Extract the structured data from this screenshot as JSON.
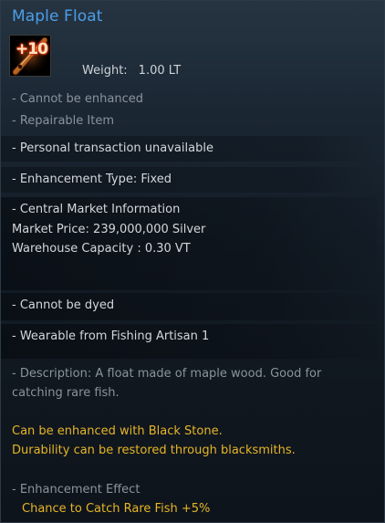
{
  "item": {
    "name": "Maple Float",
    "enhancement_badge": "+10",
    "icon": "maple-float-item-icon",
    "weight_label": "Weight:",
    "weight_value": "1.00 LT"
  },
  "properties": {
    "cannot_be_enhanced": "- Cannot be enhanced",
    "repairable": "- Repairable Item",
    "personal_transaction": "- Personal transaction unavailable",
    "enhancement_type": "- Enhancement Type: Fixed"
  },
  "market": {
    "heading": "- Central Market Information",
    "price": "Market Price: 239,000,000 Silver",
    "warehouse_capacity": "Warehouse Capacity : 0.30 VT"
  },
  "dye": "- Cannot be dyed",
  "wearable": "- Wearable from Fishing Artisan 1",
  "description": {
    "line1": "- Description: A float made of maple wood. Good for",
    "line2": "catching rare fish."
  },
  "notes": {
    "black_stone": "Can be enhanced with Black Stone.",
    "durability": "Durability can be restored through blacksmiths."
  },
  "effect": {
    "heading": "- Enhancement Effect",
    "value": "Chance to Catch Rare Fish +5%"
  },
  "colors": {
    "title": "#4c9ee8",
    "gold_text": "#e6b527",
    "dim_text": "#8a939d",
    "light_text": "#d3d7dc"
  }
}
